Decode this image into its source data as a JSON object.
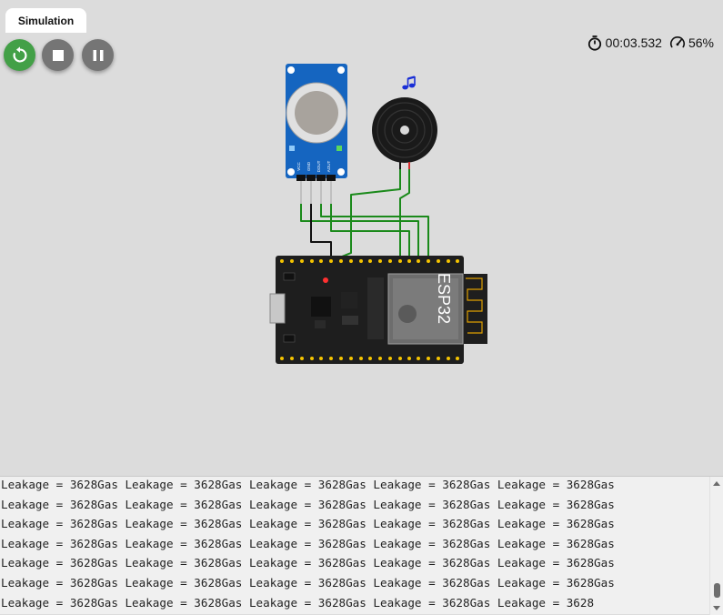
{
  "tabs": [
    {
      "label": "Simulation"
    }
  ],
  "controls": {
    "restart": {
      "icon": "restart-icon"
    },
    "stop": {
      "icon": "stop-icon"
    },
    "pause": {
      "icon": "pause-icon"
    }
  },
  "stats": {
    "elapsed_time": "00:03.532",
    "speed": "56%"
  },
  "components": {
    "gas_sensor": {
      "pins": [
        "VCC",
        "GND",
        "DOUT",
        "AOUT"
      ]
    },
    "buzzer": {
      "note_icon": "music-note-icon"
    },
    "esp32": {
      "label": "ESP32"
    }
  },
  "colors": {
    "run": "#43a047",
    "control_gray": "#757575",
    "sensor_blue": "#1565c0",
    "board_black": "#1e1e1e",
    "wire_green": "#1b8a1b"
  },
  "console": {
    "lines": [
      "Leakage = 3628Gas Leakage = 3628Gas Leakage = 3628Gas Leakage = 3628Gas Leakage = 3628Gas",
      "Leakage = 3628Gas Leakage = 3628Gas Leakage = 3628Gas Leakage = 3628Gas Leakage = 3628Gas",
      "Leakage = 3628Gas Leakage = 3628Gas Leakage = 3628Gas Leakage = 3628Gas Leakage = 3628Gas",
      "Leakage = 3628Gas Leakage = 3628Gas Leakage = 3628Gas Leakage = 3628Gas Leakage = 3628Gas",
      "Leakage = 3628Gas Leakage = 3628Gas Leakage = 3628Gas Leakage = 3628Gas Leakage = 3628Gas",
      "Leakage = 3628Gas Leakage = 3628Gas Leakage = 3628Gas Leakage = 3628Gas Leakage = 3628Gas",
      "Leakage = 3628Gas Leakage = 3628Gas Leakage = 3628Gas Leakage = 3628Gas Leakage = 3628"
    ]
  }
}
